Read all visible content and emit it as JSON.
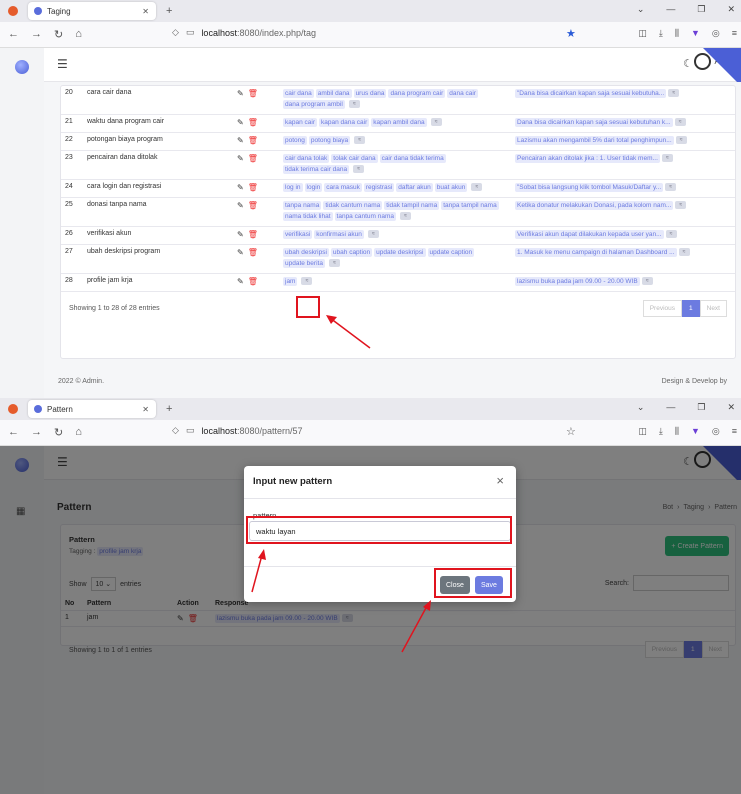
{
  "top": {
    "tab_title": "Taging",
    "address_host": "localhost",
    "address_path": ":8080/index.php/tag",
    "user": "Adm",
    "rows": [
      {
        "no": "20",
        "tagging": "cara cair dana",
        "patterns": [
          "cair dana",
          "ambil dana",
          "urus dana",
          "dana program cair",
          "dana cair",
          "dana program ambil"
        ],
        "response": "\"Dana bisa dicairkan kapan saja sesuai kebutuha..."
      },
      {
        "no": "21",
        "tagging": "waktu dana program cair",
        "patterns": [
          "kapan cair",
          "kapan dana cair",
          "kapan ambil dana"
        ],
        "response": "Dana bisa dicairkan kapan saja sesuai kebutuhan k..."
      },
      {
        "no": "22",
        "tagging": "potongan biaya program",
        "patterns": [
          "potong",
          "potong biaya"
        ],
        "response": "Lazismu akan mengambil 5% dari total penghimpun..."
      },
      {
        "no": "23",
        "tagging": "pencairan dana ditolak",
        "patterns": [
          "cair dana tolak",
          "tolak cair dana",
          "cair dana tidak terima",
          "tidak terima cair dana"
        ],
        "response": "Pencairan akan ditolak jika : 1. User tidak mem..."
      },
      {
        "no": "24",
        "tagging": "cara login dan registrasi",
        "patterns": [
          "log in",
          "login",
          "cara masuk",
          "registrasi",
          "daftar akun",
          "buat akun"
        ],
        "response": "\"Sobat bisa langsung klik tombol Masuk/Daftar y..."
      },
      {
        "no": "25",
        "tagging": "donasi tanpa nama",
        "patterns": [
          "tanpa nama",
          "tidak cantum nama",
          "tidak tampil nama",
          "tanpa tampil nama",
          "nama tidak lihat",
          "tanpa cantum nama"
        ],
        "response": "Ketika donatur melakukan Donasi, pada kolom nam..."
      },
      {
        "no": "26",
        "tagging": "verifikasi akun",
        "patterns": [
          "verifikasi",
          "konfirmasi akun"
        ],
        "response": "Verifikasi akun dapat dilakukan kepada user yan..."
      },
      {
        "no": "27",
        "tagging": "ubah deskripsi program",
        "patterns": [
          "ubah deskripsi",
          "ubah caption",
          "update deskripsi",
          "update caption",
          "update berita"
        ],
        "response": "1. Masuk ke menu campaign di halaman Dashboard ..."
      },
      {
        "no": "28",
        "tagging": "profile jam krja",
        "patterns": [
          "jam"
        ],
        "response": "lazismu buka pada jam 09.00 - 20.00 WIB"
      }
    ],
    "showing": "Showing 1 to 28 of 28 entries",
    "pager": {
      "prev": "Previous",
      "page": "1",
      "next": "Next"
    },
    "footer_left": "2022 © Admin.",
    "footer_right": "Design & Develop by"
  },
  "bottom": {
    "tab_title": "Pattern",
    "address_host": "localhost",
    "address_path": ":8080/pattern/57",
    "user": "Ad",
    "page_title": "Pattern",
    "breadcrumb": [
      "Bot",
      "Taging",
      "Pattern"
    ],
    "card_title": "Pattern",
    "tagging_label": "Tagging :",
    "tagging_value": "profile jam krja",
    "create_button": "Create Pattern",
    "show_label": "Show",
    "entries_value": "10",
    "entries_label": "entries",
    "search_label": "Search:",
    "columns": [
      "No",
      "Pattern",
      "Action",
      "Response"
    ],
    "row": {
      "no": "1",
      "pattern": "jam",
      "response": "lazismu buka pada jam 09.00 - 20.00 WIB"
    },
    "showing": "Showing 1 to 1 of 1 entries",
    "pager": {
      "prev": "Previous",
      "page": "1",
      "next": "Next"
    },
    "modal": {
      "title": "Input new pattern",
      "label": "pattern",
      "value": "waktu layan",
      "close": "Close",
      "save": "Save"
    }
  },
  "colors": {
    "accent": "#6c7be0",
    "annotation": "#e0141e",
    "create": "#2ec27e"
  }
}
